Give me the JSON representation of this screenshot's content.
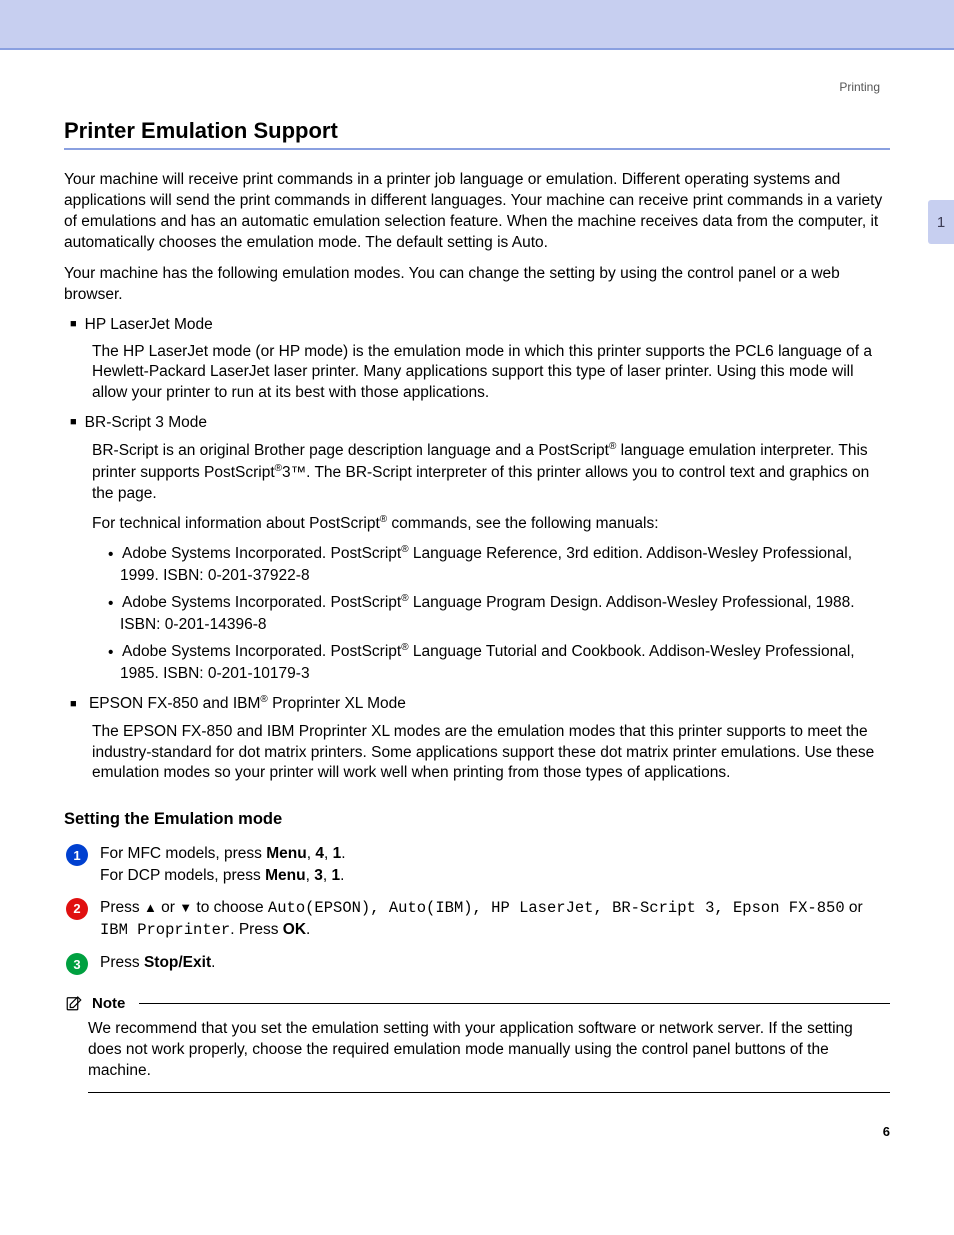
{
  "breadcrumb": "Printing",
  "chapter_tab": "1",
  "page_number": "6",
  "heading": "Printer Emulation Support",
  "intro_p1": "Your machine will receive print commands in a printer job language or emulation. Different operating systems and applications will send the print commands in different languages. Your machine can receive print commands in a variety of emulations and has an automatic emulation selection feature. When the machine receives data from the computer, it automatically chooses the emulation mode. The default setting is Auto.",
  "intro_p2": "Your machine has the following emulation modes. You can change the setting by using the control panel or a web browser.",
  "modes": {
    "hp": {
      "title": "HP LaserJet Mode",
      "desc": "The HP LaserJet mode (or HP mode) is the emulation mode in which this printer supports the PCL6 language of a Hewlett-Packard LaserJet laser printer. Many applications support this type of laser printer. Using this mode will allow your printer to run at its best with those applications."
    },
    "br": {
      "title": "BR-Script 3 Mode",
      "desc1a": "BR-Script is an original Brother page description language and a PostScript",
      "desc1b": " language emulation interpreter. This printer supports PostScript",
      "desc1c": "3™. The BR-Script interpreter of this printer allows you to control text and graphics on the page.",
      "tech_a": "For technical information about PostScript",
      "tech_b": " commands, see the following manuals:",
      "refs": [
        {
          "a": "Adobe Systems Incorporated. PostScript",
          "b": " Language Reference, 3rd edition. Addison-Wesley Professional, 1999. ISBN: 0-201-37922-8"
        },
        {
          "a": "Adobe Systems Incorporated. PostScript",
          "b": " Language Program Design. Addison-Wesley Professional, 1988. ISBN: 0-201-14396-8"
        },
        {
          "a": "Adobe Systems Incorporated. PostScript",
          "b": " Language Tutorial and Cookbook. Addison-Wesley Professional, 1985. ISBN: 0-201-10179-3"
        }
      ]
    },
    "epson": {
      "title_a": "EPSON FX-850 and IBM",
      "title_b": " Proprinter XL Mode",
      "desc": "The EPSON FX-850 and IBM Proprinter XL modes are the emulation modes that this printer supports to meet the industry-standard for dot matrix printers. Some applications support these dot matrix printer emulations. Use these emulation modes so your printer will work well when printing from those types of applications."
    }
  },
  "setting": {
    "heading": "Setting the Emulation mode",
    "step1": {
      "mfc_a": "For MFC models, press ",
      "mfc_menu": "Menu",
      "mfc_b": ", ",
      "mfc_4": "4",
      "mfc_c": ", ",
      "mfc_1": "1",
      "mfc_d": ".",
      "dcp_a": "For DCP models, press ",
      "dcp_menu": "Menu",
      "dcp_b": ", ",
      "dcp_3": "3",
      "dcp_c": ", ",
      "dcp_1": "1",
      "dcp_d": "."
    },
    "step2": {
      "a": "Press ",
      "up": "▲",
      "b": " or ",
      "down": "▼",
      "c": " to choose ",
      "opts": "Auto(EPSON), Auto(IBM), HP LaserJet, BR-Script 3, Epson FX-850",
      "d": " or ",
      "opt_last": "IBM Proprinter",
      "e": ". Press ",
      "ok": "OK",
      "f": "."
    },
    "step3": {
      "a": "Press ",
      "stop": "Stop/Exit",
      "b": "."
    }
  },
  "note": {
    "label": "Note",
    "text": "We recommend that you set the emulation setting with your application software or network server. If the setting does not work properly, choose the required emulation mode manually using the control panel buttons of the machine."
  }
}
